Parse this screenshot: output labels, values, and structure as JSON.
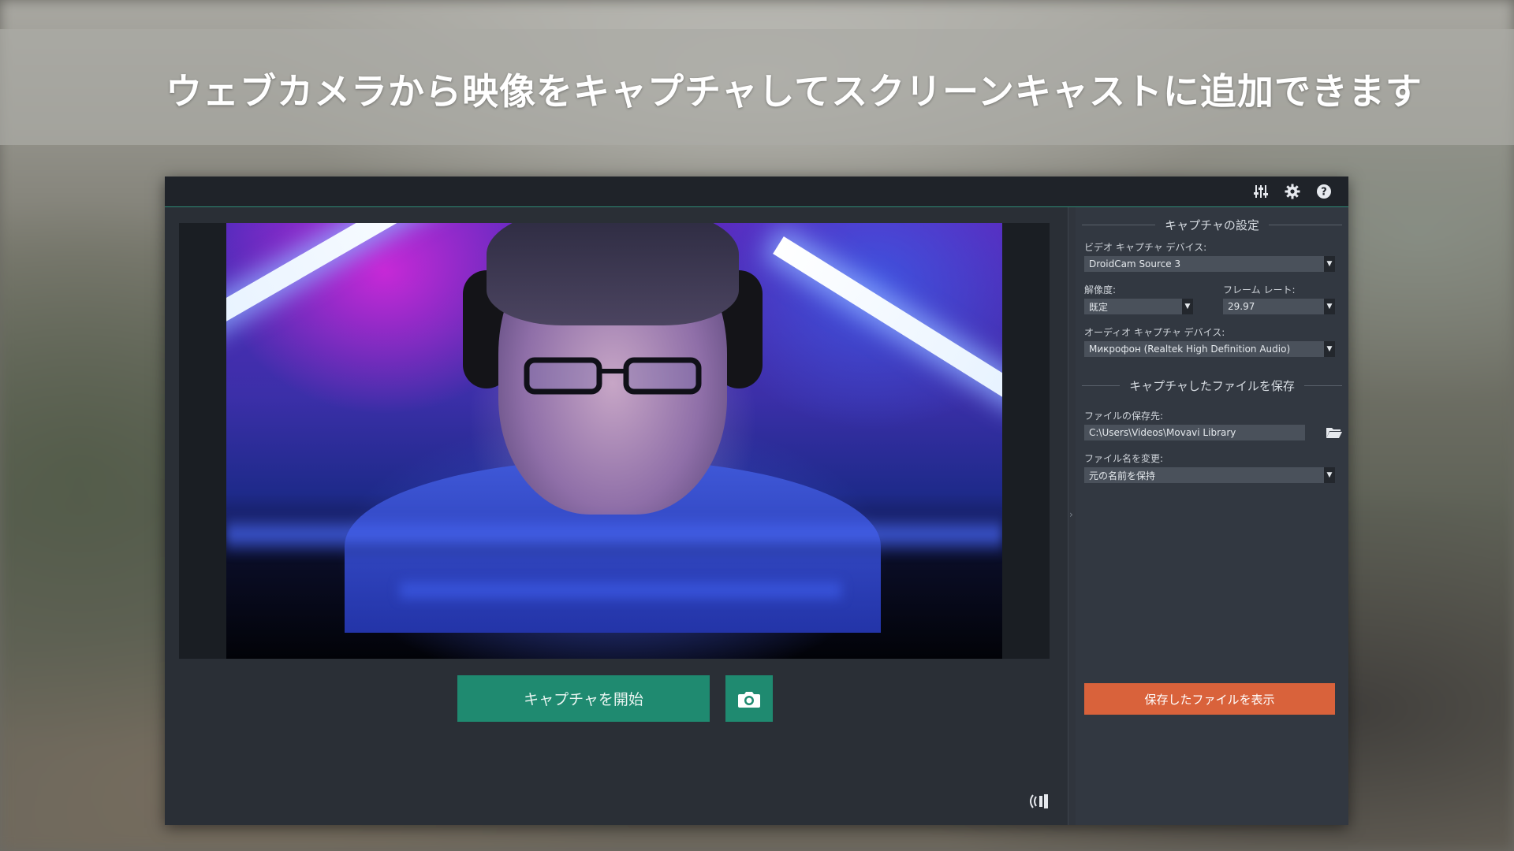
{
  "banner": {
    "headline": "ウェブカメラから映像をキャプチャしてスクリーンキャストに追加できます"
  },
  "toolbar": {
    "icons": [
      "mixer-sliders-icon",
      "gear-icon",
      "help-icon"
    ]
  },
  "main": {
    "capture_button": "キャプチャを開始",
    "snapshot_icon": "camera-icon",
    "audio_icon": "audio-waves-icon"
  },
  "panel": {
    "capture_settings": {
      "heading": "キャプチャの設定",
      "video_device_label": "ビデオ キャプチャ デバイス:",
      "video_device_value": "DroidCam Source 3",
      "resolution_label": "解像度:",
      "resolution_value": "既定",
      "framerate_label": "フレーム レート:",
      "framerate_value": "29.97",
      "audio_device_label": "オーディオ キャプチャ デバイス:",
      "audio_device_value": "Микрофон (Realtek High Definition Audio)"
    },
    "save_settings": {
      "heading": "キャプチャしたファイルを保存",
      "save_path_label": "ファイルの保存先:",
      "save_path_value": "C:\\Users\\Videos\\Movavi Library",
      "rename_label": "ファイル名を変更:",
      "rename_value": "元の名前を保持",
      "show_files_button": "保存したファイルを表示"
    }
  },
  "colors": {
    "accent_green": "#1f8a70",
    "accent_orange": "#d9623b",
    "window_bg": "#2a2f36",
    "panel_bg": "#323841"
  }
}
